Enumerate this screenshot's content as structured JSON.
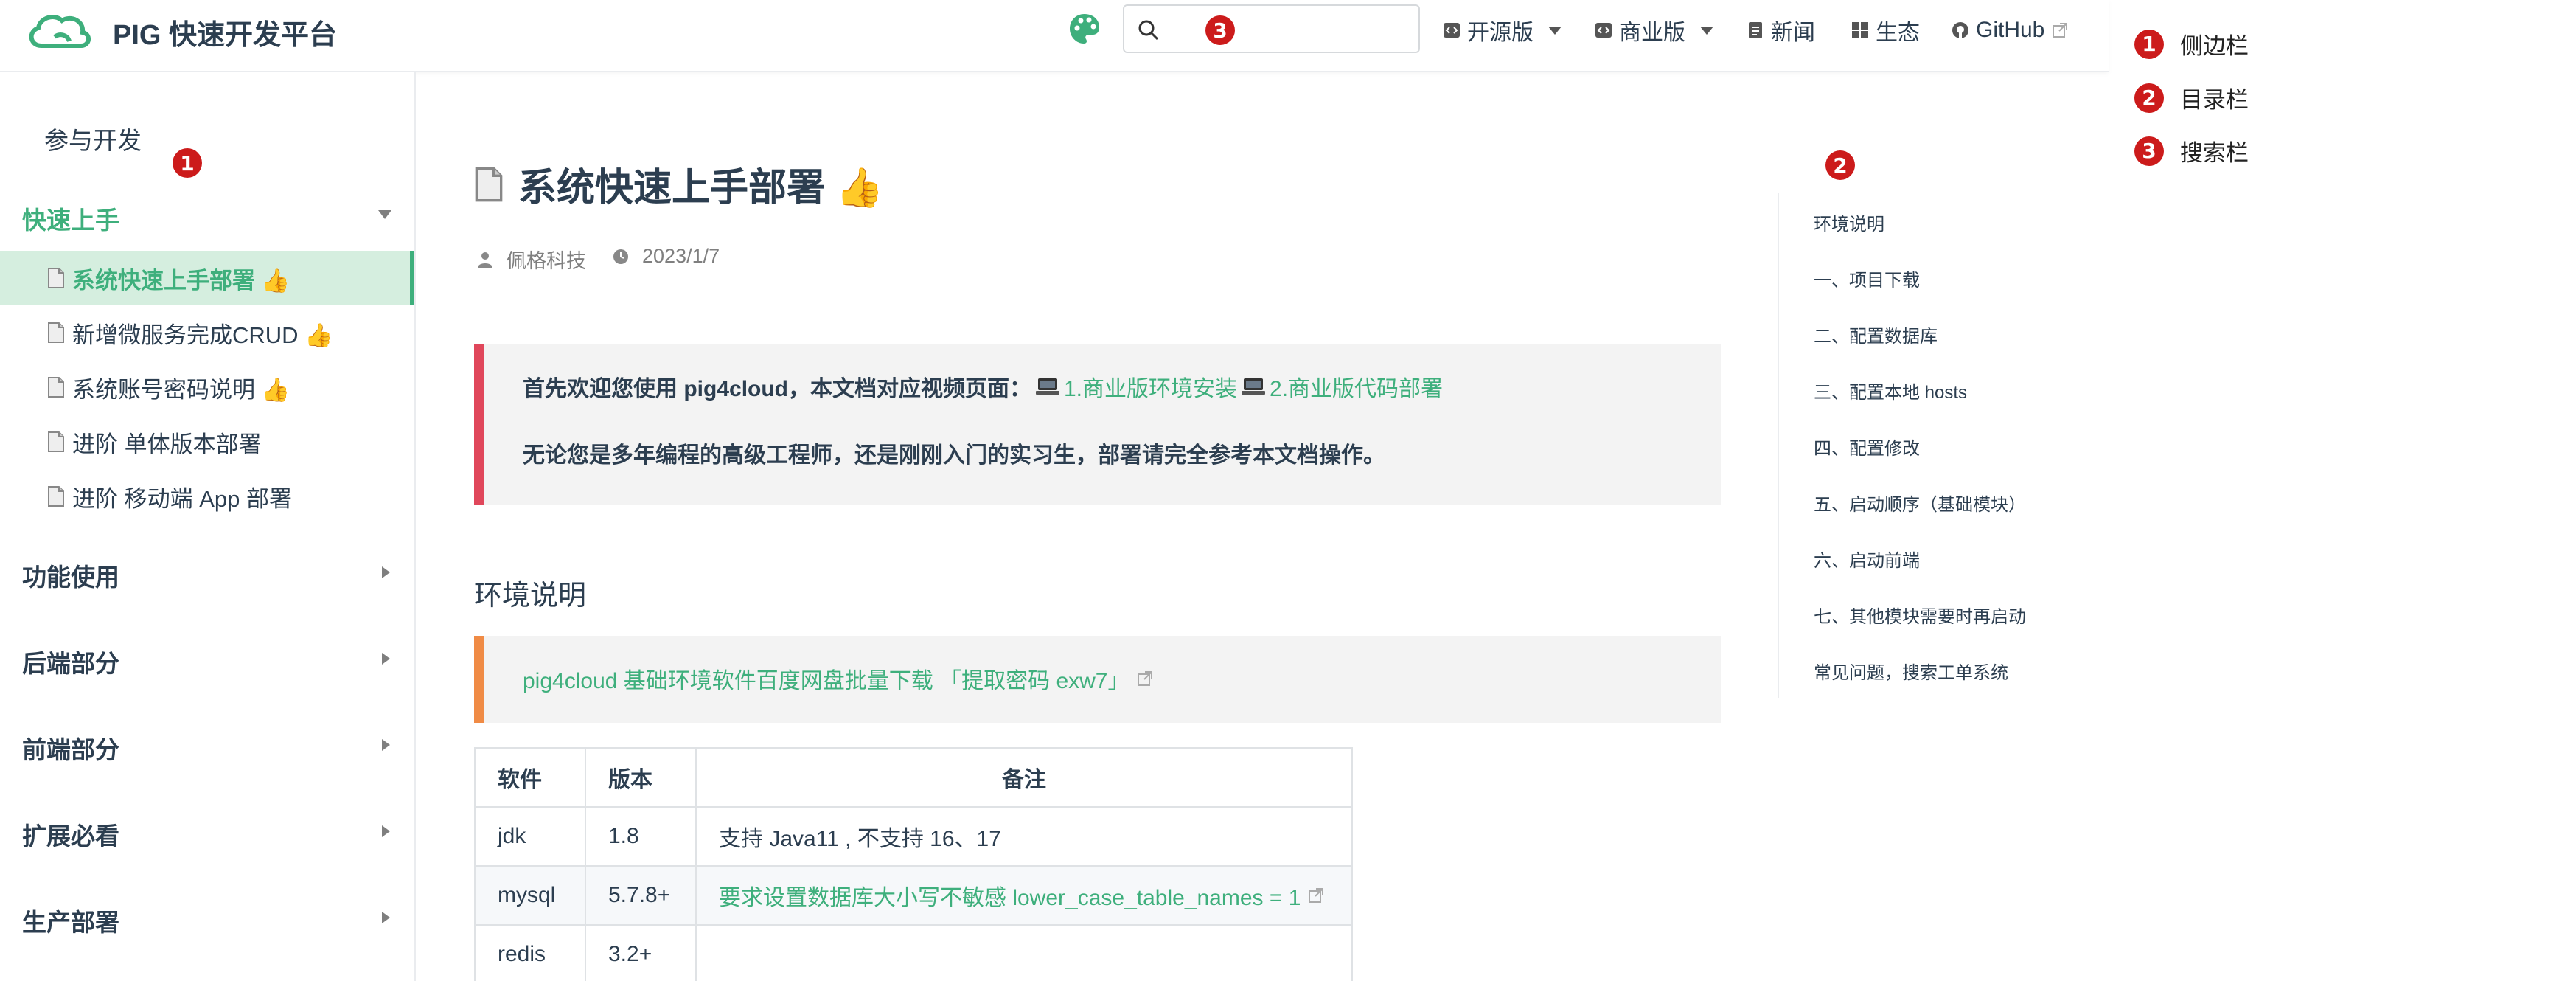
{
  "header": {
    "title": "PIG 快速开发平台",
    "search": {
      "placeholder": ""
    },
    "nav": [
      {
        "label": "开源版",
        "icon": "code-icon",
        "dropdown": true
      },
      {
        "label": "商业版",
        "icon": "code-icon",
        "dropdown": true
      },
      {
        "label": "新闻",
        "icon": "document-icon",
        "dropdown": false
      },
      {
        "label": "生态",
        "icon": "grid-icon",
        "dropdown": false
      },
      {
        "label": "GitHub",
        "icon": "github-icon",
        "external": true
      }
    ]
  },
  "sidebar": {
    "top_link": "参与开发",
    "groups": [
      {
        "title": "快速上手",
        "open": true,
        "items": [
          {
            "label": "系统快速上手部署 👍",
            "active": true
          },
          {
            "label": "新增微服务完成CRUD 👍"
          },
          {
            "label": "系统账号密码说明 👍"
          },
          {
            "label": "进阶 单体版本部署"
          },
          {
            "label": "进阶 移动端 App 部署"
          }
        ]
      },
      {
        "title": "功能使用",
        "open": false
      },
      {
        "title": "后端部分",
        "open": false
      },
      {
        "title": "前端部分",
        "open": false
      },
      {
        "title": "扩展必看",
        "open": false
      },
      {
        "title": "生产部署",
        "open": false
      }
    ]
  },
  "page": {
    "title": "系统快速上手部署 👍",
    "author": "佩格科技",
    "date": "2023/1/7",
    "tip": {
      "line1_prefix": "首先欢迎您使用 pig4cloud，本文档对应视频页面：",
      "link1": "1.商业版环境安装",
      "link2": "2.商业版代码部署",
      "line2": "无论您是多年编程的高级工程师，还是刚刚入门的实习生，部署请完全参考本文档操作。"
    },
    "section_title": "环境说明",
    "warning_link": "pig4cloud 基础环境软件百度网盘批量下载 「提取密码 exw7」",
    "table": {
      "headers": [
        "软件",
        "版本",
        "备注"
      ],
      "rows": [
        {
          "software": "jdk",
          "version": "1.8",
          "note": "支持 Java11 , 不支持 16、17",
          "note_is_link": false
        },
        {
          "software": "mysql",
          "version": "5.7.8+",
          "note": "要求设置数据库大小写不敏感 lower_case_table_names = 1",
          "note_is_link": true
        },
        {
          "software": "redis",
          "version": "3.2+",
          "note": "",
          "note_is_link": false
        }
      ]
    }
  },
  "toc": [
    "环境说明",
    "一、项目下载",
    "二、配置数据库",
    "三、配置本地 hosts",
    "四、配置修改",
    "五、启动顺序（基础模块）",
    "六、启动前端",
    "七、其他模块需要时再启动",
    "常见问题，搜索工单系统"
  ],
  "annotations": {
    "markers": [
      "1",
      "2",
      "3"
    ],
    "legend": [
      {
        "num": "1",
        "label": "侧边栏"
      },
      {
        "num": "2",
        "label": "目录栏"
      },
      {
        "num": "3",
        "label": "搜索栏"
      }
    ]
  },
  "colors": {
    "accent": "#3eaf7c",
    "tip_border": "#e0475b",
    "warning_border": "#f08b45",
    "marker": "#cc1b1b"
  }
}
